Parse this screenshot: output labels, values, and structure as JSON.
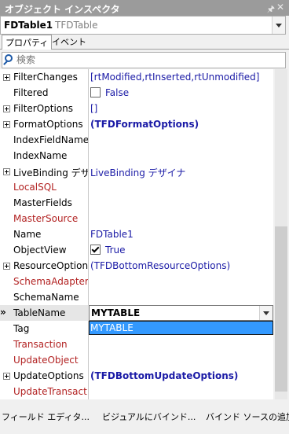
{
  "window": {
    "title": "オブジェクト インスペクタ",
    "pin_icon": "pin-icon",
    "close_icon": "close-icon"
  },
  "object_selector": {
    "name": "FDTable1",
    "class": "TFDTable"
  },
  "tabs": [
    {
      "label": "プロパティ"
    },
    {
      "label": "イベント"
    }
  ],
  "search": {
    "placeholder": "検索"
  },
  "properties": [
    {
      "name": "FilterChanges",
      "value": "[rtModified,rtInserted,rtUnmodified]",
      "expand": true
    },
    {
      "name": "Filtered",
      "value": "False",
      "checkbox": true,
      "checked": false
    },
    {
      "name": "FilterOptions",
      "value": "[]",
      "expand": true
    },
    {
      "name": "FormatOptions",
      "value": "(TFDFormatOptions)",
      "expand": true,
      "bold": true
    },
    {
      "name": "IndexFieldNames",
      "value": ""
    },
    {
      "name": "IndexName",
      "value": ""
    },
    {
      "name": "LiveBinding デザイナ",
      "value": "LiveBinding デザイナ",
      "expand": true
    },
    {
      "name": "LocalSQL",
      "value": "",
      "event": true
    },
    {
      "name": "MasterFields",
      "value": ""
    },
    {
      "name": "MasterSource",
      "value": "",
      "event": true
    },
    {
      "name": "Name",
      "value": "FDTable1"
    },
    {
      "name": "ObjectView",
      "value": "True",
      "checkbox": true,
      "checked": true
    },
    {
      "name": "ResourceOptions",
      "value": "(TFDBottomResourceOptions)",
      "expand": true
    },
    {
      "name": "SchemaAdapter",
      "value": "",
      "event": true
    },
    {
      "name": "SchemaName",
      "value": ""
    },
    {
      "name": "TableName",
      "value": "MYTABLE",
      "selected": true
    },
    {
      "name": "Tag",
      "value": ""
    },
    {
      "name": "Transaction",
      "value": "",
      "event": true
    },
    {
      "name": "UpdateObject",
      "value": "",
      "event": true
    },
    {
      "name": "UpdateOptions",
      "value": "(TFDBottomUpdateOptions)",
      "expand": true,
      "bold": true
    },
    {
      "name": "UpdateTransaction",
      "value": "",
      "event": true
    }
  ],
  "dropdown": {
    "options": [
      "MYTABLE"
    ]
  },
  "status_links": [
    {
      "label": "フィールド エディタ..."
    },
    {
      "label": "ビジュアルにバインド..."
    },
    {
      "label": "バインド ソースの追加"
    }
  ],
  "colors": {
    "title_bg": "#9b9b9b",
    "value_text": "#1a1aa6",
    "event_text": "#b22222",
    "selection": "#3399ff"
  }
}
